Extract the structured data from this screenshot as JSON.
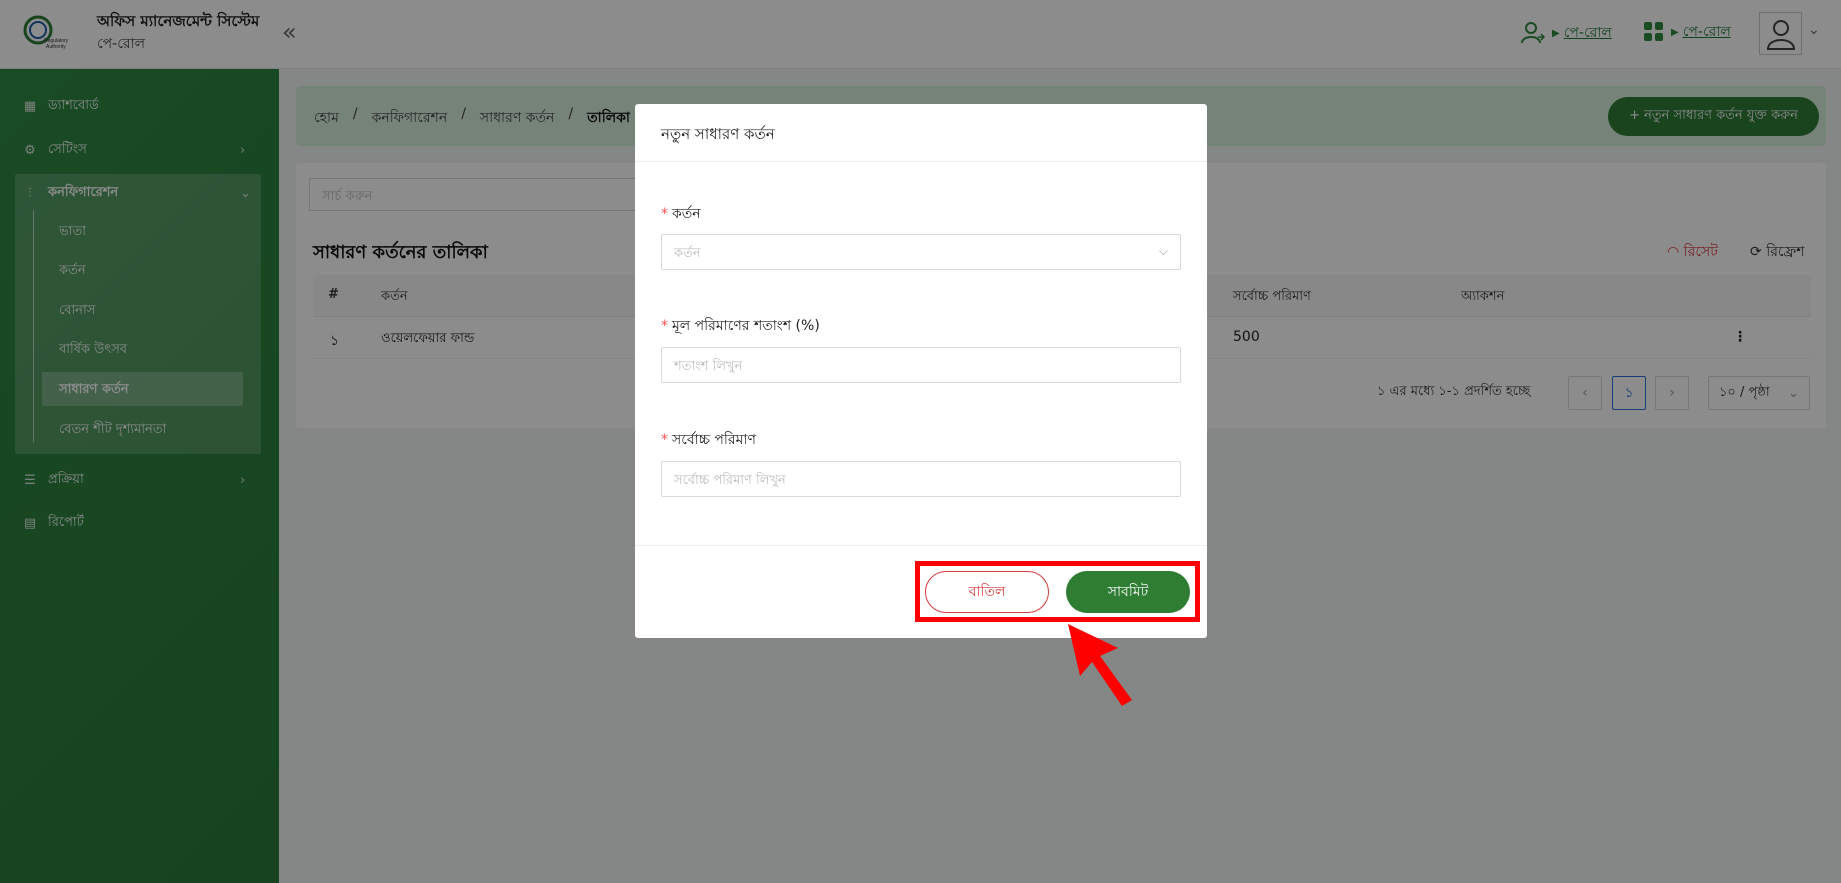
{
  "header": {
    "app_title": "অফিস ম্যানেজমেন্ট সিস্টেম",
    "app_subtitle": "পে-রোল",
    "collapse_icon": "«",
    "link1_label": "পে-রোল",
    "link2_label": "পে-রোল",
    "logo_text": "Bangladesh Regulatory Authority"
  },
  "sidebar": {
    "items": [
      {
        "label": "ড্যাশবোর্ড",
        "icon": "dashboard-icon"
      },
      {
        "label": "সেটিংস",
        "icon": "gear-icon"
      },
      {
        "label": "কনফিগারেশন",
        "icon": "sliders-icon"
      },
      {
        "label": "প্রক্রিয়া",
        "icon": "process-icon"
      },
      {
        "label": "রিপোর্ট",
        "icon": "report-icon"
      }
    ],
    "sub_items": [
      "ভাতা",
      "কর্তন",
      "বোনাস",
      "বার্ষিক উৎসব",
      "সাধারণ কর্তন",
      "বেতন শীট দৃশ্যমানতা"
    ]
  },
  "breadcrumb": [
    "হোম",
    "কনফিগারেশন",
    "সাধারণ কর্তন",
    "তালিকা"
  ],
  "add_button": "+ নতুন সাধারণ কর্তন যুক্ত করুন",
  "search_placeholder": "সার্চ করুন",
  "table": {
    "title": "সাধারণ কর্তনের তালিকা",
    "reset": "রিসেট",
    "refresh": "রিফ্রেশ",
    "headers": [
      "#",
      "কর্তন",
      "সর্বোচ্চ পরিমাণ",
      "অ্যাকশন"
    ],
    "rows": [
      {
        "index": "১",
        "name": "ওয়েলফেয়ার ফান্ড",
        "max": "500",
        "action": "⋮"
      }
    ]
  },
  "pagination": {
    "summary": "১ এর মধ্যে ১-১ প্রদর্শিত হচ্ছে",
    "current": "১",
    "page_size": "১০ / পৃষ্ঠা"
  },
  "modal": {
    "title": "নতুন সাধারণ কর্তন",
    "field1_label": "কর্তন",
    "field1_placeholder": "কর্তন",
    "field2_label": "মূল পরিমাণের শতাংশ (%)",
    "field2_placeholder": "শতাংশ লিখুন",
    "field3_label": "সর্বোচ্চ পরিমাণ",
    "field3_placeholder": "সর্বোচ্চ পরিমাণ লিখুন",
    "cancel": "বাতিল",
    "submit": "সাবমিট"
  }
}
